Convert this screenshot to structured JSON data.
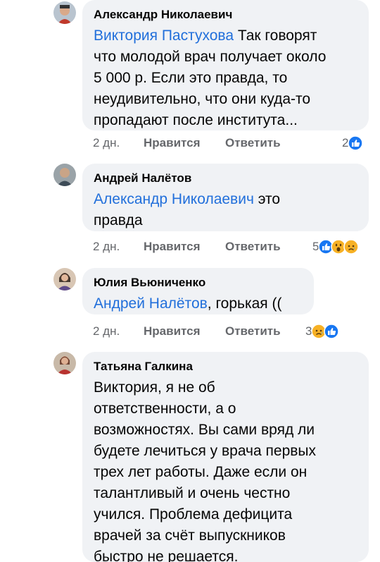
{
  "comments": [
    {
      "author": "Александр Николаевич",
      "mention": "Виктория Пастухова",
      "text_lines": [
        " Так говорят",
        "что молодой врач получает около",
        "5 000 р. Если это правда, то",
        "неудивительно, что они куда-то",
        "пропадают после института..."
      ],
      "time": "2 дн.",
      "like": "Нравится",
      "reply": "Ответить",
      "reaction_count": "2",
      "reactions": [
        "like-icon"
      ]
    },
    {
      "author": "Андрей Налётов",
      "mention": "Александр Николаевич",
      "text_lines": [
        " это",
        "правда"
      ],
      "time": "2 дн.",
      "like": "Нравится",
      "reply": "Ответить",
      "reaction_count": "5",
      "reactions": [
        "like-icon",
        "wow-icon",
        "sad-icon"
      ]
    },
    {
      "author": "Юлия Вьюниченко",
      "mention": "Андрей Налётов",
      "text_lines": [
        ", горькая (("
      ],
      "time": "2 дн.",
      "like": "Нравится",
      "reply": "Ответить",
      "reaction_count": "3",
      "reactions": [
        "sad-icon",
        "like-icon"
      ]
    },
    {
      "author": "Татьяна Галкина",
      "text_lines": [
        "Виктория, я не об",
        "ответственности, а о",
        "возможностях. Вы сами вряд ли",
        "будете лечиться у врача первых",
        "трех лет работы. Даже если он",
        "талантливый и очень честно",
        "учился. Проблема дефицита",
        "врачей за счёт выпускников",
        "быстро не решается."
      ]
    }
  ],
  "colors": {
    "bubble": "#f0f2f5",
    "mention": "#216fdb",
    "meta": "#65676b",
    "like_blue": "#1877f2",
    "react_yellow": "#f7b125"
  }
}
